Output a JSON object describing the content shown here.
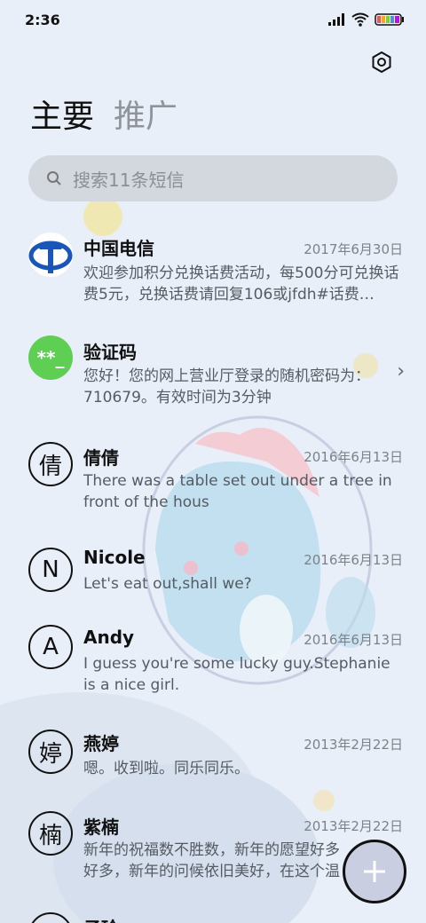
{
  "status_bar": {
    "time": "2:36"
  },
  "header": {
    "tabs": [
      {
        "label": "主要"
      },
      {
        "label": "推广"
      }
    ]
  },
  "search": {
    "placeholder": "搜索11条短信"
  },
  "conversations": [
    {
      "name": "中国电信",
      "date": "2017年6月30日",
      "preview": "欢迎参加积分兑换话费活动，每500分可兑换话费5元，兑换话费请回复106或jfdh#话费…",
      "avatar": "china-telecom-logo"
    },
    {
      "name": "验证码",
      "date": "",
      "preview": "您好！您的网上营业厅登录的随机密码为：710679。有效时间为3分钟",
      "avatar_text": "**_"
    },
    {
      "name": "倩倩",
      "date": "2016年6月13日",
      "preview": "There was a table set out under a tree in front of the hous",
      "avatar_text": "倩"
    },
    {
      "name": "Nicole",
      "date": "2016年6月13日",
      "preview": "Let's eat out,shall we?",
      "avatar_text": "N"
    },
    {
      "name": "Andy",
      "date": "2016年6月13日",
      "preview": "I guess you're some lucky guy.Stephanie is a nice girl.",
      "avatar_text": "A"
    },
    {
      "name": "燕婷",
      "date": "2013年2月22日",
      "preview": "嗯。收到啦。同乐同乐。",
      "avatar_text": "婷"
    },
    {
      "name": "紫楠",
      "date": "2013年2月22日",
      "preview": "新年的祝福数不胜数，新年的愿望好多好多，新年的问候依旧美好，在这个温馨的时刻",
      "avatar_text": "楠"
    },
    {
      "name": "子玲",
      "date": "",
      "preview": "",
      "avatar_text": ""
    }
  ],
  "colors": {
    "background": "#e9eff8",
    "verify_avatar": "#5fcf53",
    "telecom_blue": "#1a56b8"
  }
}
